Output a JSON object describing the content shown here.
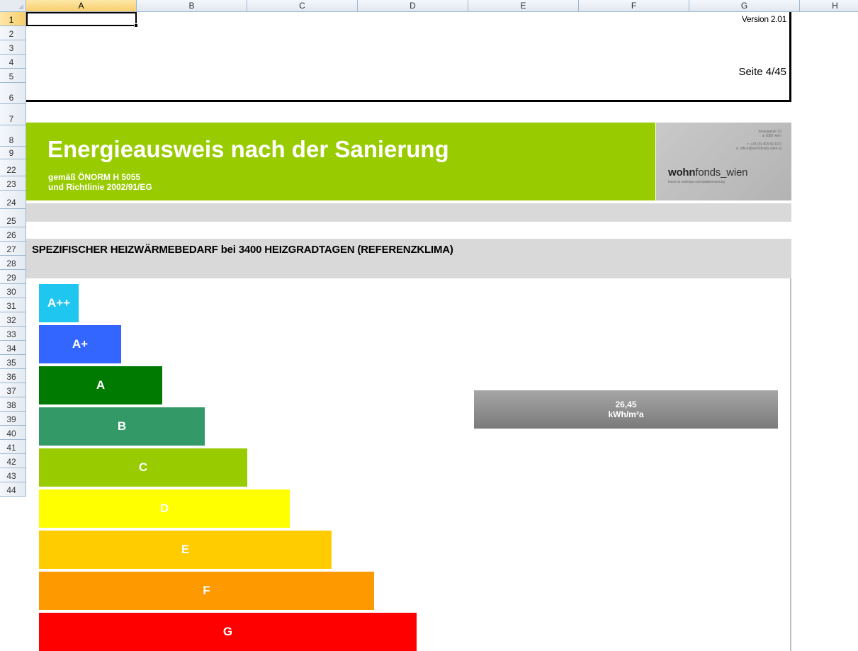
{
  "spreadsheet": {
    "columns": [
      "A",
      "B",
      "C",
      "D",
      "E",
      "F",
      "G",
      "H"
    ],
    "rows": [
      "1",
      "2",
      "3",
      "4",
      "5",
      "6",
      "7",
      "8",
      "9",
      "22",
      "23",
      "24",
      "25",
      "26",
      "27",
      "28",
      "29",
      "30",
      "31",
      "32",
      "33",
      "34",
      "35",
      "36",
      "37",
      "38",
      "39",
      "40",
      "41",
      "42",
      "43",
      "44"
    ],
    "active_cell": "A1"
  },
  "header": {
    "version": "Version 2.01",
    "page": "Seite 4/45"
  },
  "banner": {
    "title": "Energieausweis nach der Sanierung",
    "subtitle_1": "gemäß ÖNORM H 5055",
    "subtitle_2": "und Richtlinie 2002/91/EG",
    "color": "#99cc00"
  },
  "logo": {
    "address_1": "lenaugasse 10",
    "address_2": "a-1082 wien",
    "address_3": "t: +43 (0) 403 59 19 0",
    "address_4": "e: office@wohnfonds.wien.at",
    "name_bold": "wohn",
    "name_rest": "fonds_wien",
    "tagline": "fonds für wohnbau und stadterneuerung"
  },
  "heating": {
    "title": "SPEZIFISCHER HEIZWÄRMEBEDARF bei 3400 HEIZGRADTAGEN (REFERENZKLIMA)"
  },
  "energy_scale": [
    {
      "label": "A++",
      "color": "#1ec6f0"
    },
    {
      "label": "A+",
      "color": "#3366ff"
    },
    {
      "label": "A",
      "color": "#007a00"
    },
    {
      "label": "B",
      "color": "#339966"
    },
    {
      "label": "C",
      "color": "#99cc00"
    },
    {
      "label": "D",
      "color": "#ffff00"
    },
    {
      "label": "E",
      "color": "#ffcc00"
    },
    {
      "label": "F",
      "color": "#ff9900"
    },
    {
      "label": "G",
      "color": "#ff0000"
    }
  ],
  "result": {
    "value": "26,45",
    "unit": "kWh/m²a"
  }
}
